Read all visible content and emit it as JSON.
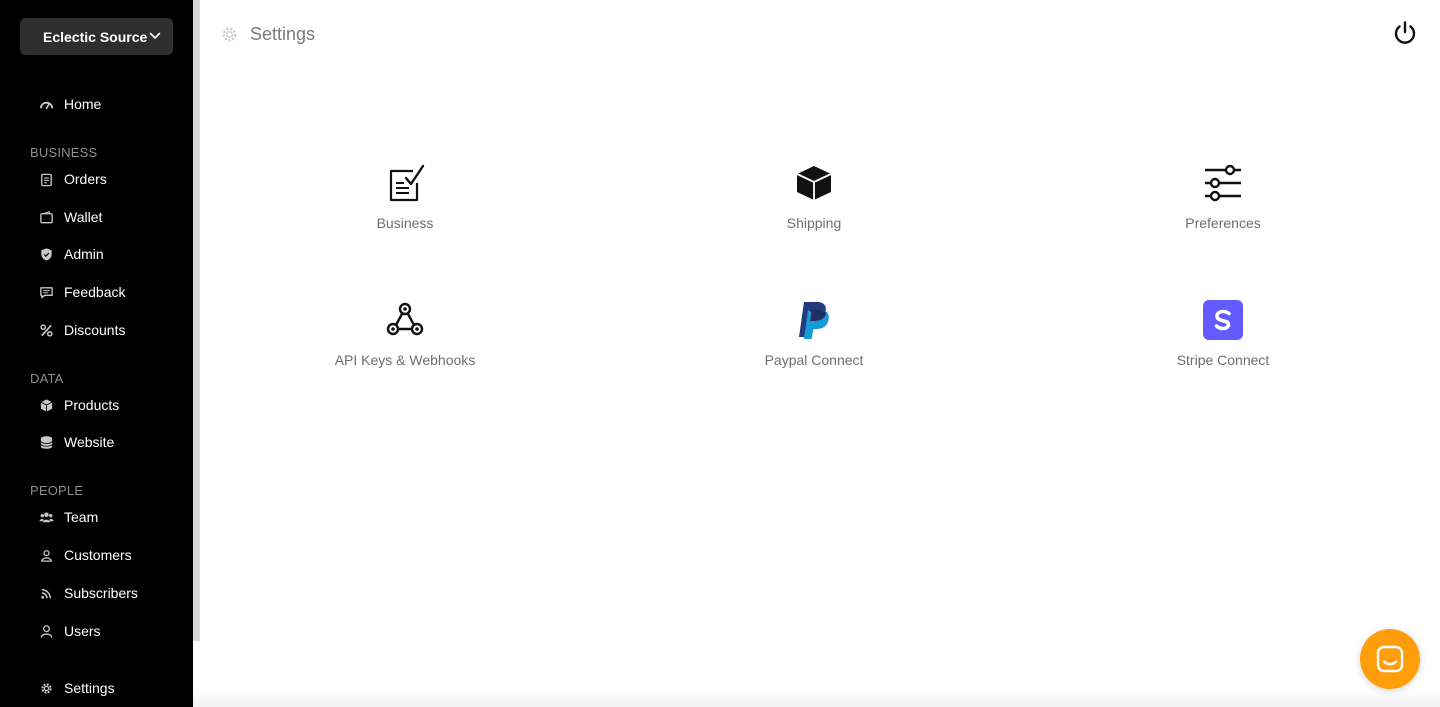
{
  "store": {
    "name": "Eclectic Source",
    "chevron_icon": "chevron-down-icon"
  },
  "sidebar": {
    "home": {
      "label": "Home",
      "icon": "gauge-icon"
    },
    "sections": [
      {
        "title": "BUSINESS",
        "items": [
          {
            "label": "Orders",
            "icon": "clipboard-icon"
          },
          {
            "label": "Wallet",
            "icon": "wallet-icon"
          },
          {
            "label": "Admin",
            "icon": "shield-icon"
          },
          {
            "label": "Feedback",
            "icon": "comment-icon"
          },
          {
            "label": "Discounts",
            "icon": "percent-icon"
          }
        ]
      },
      {
        "title": "DATA",
        "items": [
          {
            "label": "Products",
            "icon": "cube-icon"
          },
          {
            "label": "Website",
            "icon": "database-icon"
          }
        ]
      },
      {
        "title": "PEOPLE",
        "items": [
          {
            "label": "Team",
            "icon": "users-icon"
          },
          {
            "label": "Customers",
            "icon": "user-icon"
          },
          {
            "label": "Subscribers",
            "icon": "rss-icon"
          },
          {
            "label": "Users",
            "icon": "user-outline-icon"
          }
        ]
      }
    ],
    "settings": {
      "label": "Settings",
      "icon": "gear-icon"
    }
  },
  "header": {
    "title": "Settings",
    "icon": "gear-icon",
    "power_icon": "power-icon"
  },
  "tiles": [
    {
      "label": "Business",
      "icon": "clipboard-check-icon"
    },
    {
      "label": "Shipping",
      "icon": "box-icon"
    },
    {
      "label": "Preferences",
      "icon": "sliders-icon"
    },
    {
      "label": "API Keys & Webhooks",
      "icon": "webhook-icon"
    },
    {
      "label": "Paypal Connect",
      "icon": "paypal-icon"
    },
    {
      "label": "Stripe Connect",
      "icon": "stripe-icon"
    }
  ],
  "colors": {
    "sidebar_bg": "#000000",
    "accent_chat": "#ff9d0a",
    "stripe": "#635bff",
    "paypal_dark": "#253b80",
    "paypal_light": "#179bd7"
  },
  "chat": {
    "icon": "chat-icon"
  }
}
